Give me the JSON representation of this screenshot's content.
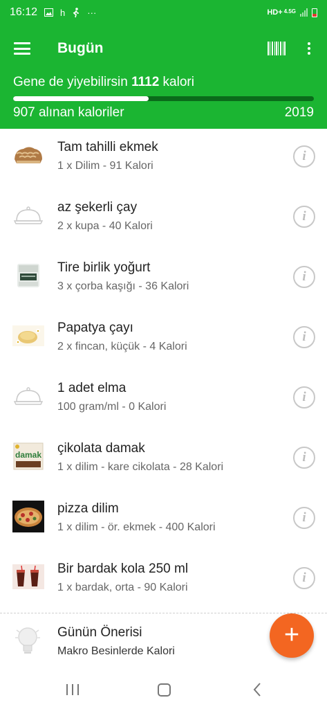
{
  "status_bar": {
    "time": "16:12",
    "carrier_letter": "h",
    "more": "···",
    "network": "HD+",
    "network_sup": "4.5G"
  },
  "app_bar": {
    "title": "Bugün"
  },
  "summary": {
    "remaining_prefix": "Gene de yiyebilirsin",
    "remaining_value": "1112",
    "remaining_suffix": "kalori",
    "eaten_label": "907 alınan kaloriler",
    "goal": "2019",
    "progress_fraction": 0.45
  },
  "foods": [
    {
      "name": "Tam tahilli ekmek",
      "detail": "1 x Dilim - 91 Kalori",
      "thumb": "bread-thumbnail"
    },
    {
      "name": "az şekerli çay",
      "detail": "2 x kupa - 40 Kalori",
      "thumb": "dish-placeholder-icon"
    },
    {
      "name": "Tire birlik yoğurt",
      "detail": "3 x çorba kaşığı - 36 Kalori",
      "thumb": "yogurt-thumbnail"
    },
    {
      "name": "Papatya çayı",
      "detail": "2 x fincan, küçük - 4 Kalori",
      "thumb": "chamomile-tea-thumbnail"
    },
    {
      "name": "1 adet elma",
      "detail": "100 gram/ml - 0 Kalori",
      "thumb": "dish-placeholder-icon"
    },
    {
      "name": "çikolata damak",
      "detail": "1 x dilim - kare cikolata - 28 Kalori",
      "thumb": "chocolate-thumbnail",
      "thumb_text": "damak"
    },
    {
      "name": "pizza dilim",
      "detail": "1 x dilim - ör. ekmek - 400 Kalori",
      "thumb": "pizza-thumbnail"
    },
    {
      "name": "Bir bardak kola 250 ml",
      "detail": "1 x bardak, orta - 90 Kalori",
      "thumb": "cola-thumbnail"
    }
  ],
  "tip": {
    "title": "Günün Önerisi",
    "subtitle": "Makro Besinlerde Kalori"
  },
  "fab": {
    "label": "+"
  },
  "colors": {
    "primary_green": "#1bb532",
    "fab_orange": "#f36621",
    "progress_track": "#0a6b1a"
  }
}
